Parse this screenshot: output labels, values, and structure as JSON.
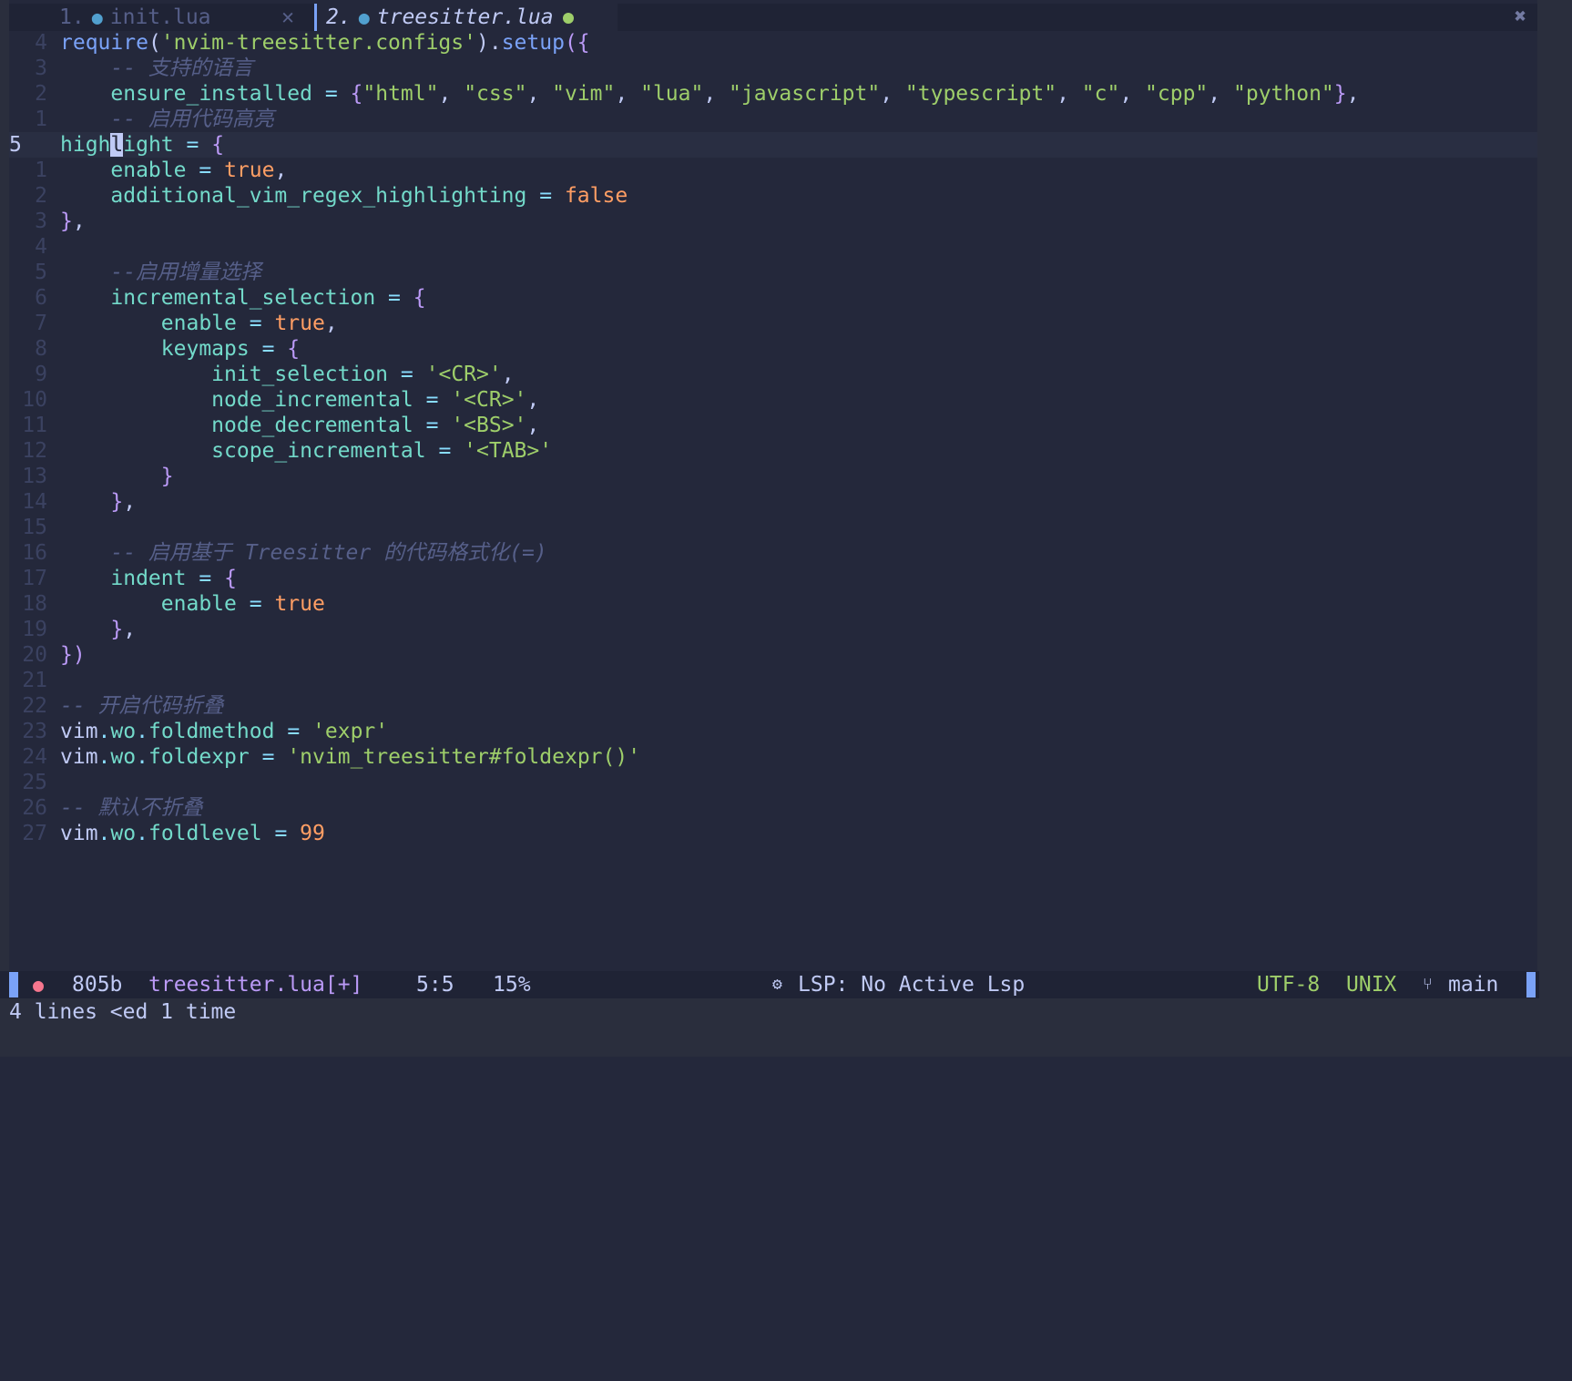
{
  "tabs": [
    {
      "number": "1.",
      "name": "init.lua",
      "close": "✕"
    },
    {
      "number": "2.",
      "name": "treesitter.lua"
    }
  ],
  "tabline": {
    "close_all": "✖"
  },
  "code_lines": [
    {
      "ln": "4",
      "html": "<span class='m'>require</span><span class='w'>(</span><span class='s'>'nvim-treesitter.configs'</span><span class='w'>).</span><span class='m'>setup</span><span class='p'>({</span>"
    },
    {
      "ln": "3",
      "html": "    <span class='c'>-- 支持的语言</span>"
    },
    {
      "ln": "2",
      "html": "    <span class='v'>ensure_installed</span> <span class='o'>=</span> <span class='p'>{</span><span class='s'>\"html\"</span><span class='w'>, </span><span class='s'>\"css\"</span><span class='w'>, </span><span class='s'>\"vim\"</span><span class='w'>, </span><span class='s'>\"lua\"</span><span class='w'>, </span><span class='s'>\"javascript\"</span><span class='w'>, </span><span class='s'>\"typescript\"</span><span class='w'>, </span><span class='s'>\"c\"</span><span class='w'>, </span><span class='s'>\"cpp\"</span><span class='w'>, </span><span class='s'>\"python\"</span><span class='p'>}</span><span class='w'>,</span>"
    },
    {
      "ln": "1",
      "html": "    <span class='c'>-- 启用代码高亮</span>"
    },
    {
      "ln": "5",
      "cur": true,
      "html": "<span class='v'>high</span><span class='cursor'>l</span><span class='v'>ight</span> <span class='o'>=</span> <span class='p'>{</span>"
    },
    {
      "ln": "1",
      "html": "    <span class='v'>enable</span> <span class='o'>=</span> <span class='k'>true</span><span class='w'>,</span>"
    },
    {
      "ln": "2",
      "html": "    <span class='v'>additional_vim_regex_highlighting</span> <span class='o'>=</span> <span class='k'>false</span>"
    },
    {
      "ln": "3",
      "html": "<span class='p'>}</span><span class='w'>,</span>"
    },
    {
      "ln": "4",
      "html": ""
    },
    {
      "ln": "5",
      "html": "    <span class='c'>--启用增量选择</span>"
    },
    {
      "ln": "6",
      "html": "    <span class='v'>incremental_selection</span> <span class='o'>=</span> <span class='p'>{</span>"
    },
    {
      "ln": "7",
      "html": "        <span class='v'>enable</span> <span class='o'>=</span> <span class='k'>true</span><span class='w'>,</span>"
    },
    {
      "ln": "8",
      "html": "        <span class='v'>keymaps</span> <span class='o'>=</span> <span class='p'>{</span>"
    },
    {
      "ln": "9",
      "html": "            <span class='v'>init_selection</span> <span class='o'>=</span> <span class='s'>'&lt;CR&gt;'</span><span class='w'>,</span>"
    },
    {
      "ln": "10",
      "html": "            <span class='v'>node_incremental</span> <span class='o'>=</span> <span class='s'>'&lt;CR&gt;'</span><span class='w'>,</span>"
    },
    {
      "ln": "11",
      "html": "            <span class='v'>node_decremental</span> <span class='o'>=</span> <span class='s'>'&lt;BS&gt;'</span><span class='w'>,</span>"
    },
    {
      "ln": "12",
      "html": "            <span class='v'>scope_incremental</span> <span class='o'>=</span> <span class='s'>'&lt;TAB&gt;'</span>"
    },
    {
      "ln": "13",
      "html": "        <span class='p'>}</span>"
    },
    {
      "ln": "14",
      "html": "    <span class='p'>}</span><span class='w'>,</span>"
    },
    {
      "ln": "15",
      "html": ""
    },
    {
      "ln": "16",
      "html": "    <span class='c'>-- 启用基于 Treesitter 的代码格式化(=)</span>"
    },
    {
      "ln": "17",
      "html": "    <span class='v'>indent</span> <span class='o'>=</span> <span class='p'>{</span>"
    },
    {
      "ln": "18",
      "html": "        <span class='v'>enable</span> <span class='o'>=</span> <span class='k'>true</span>"
    },
    {
      "ln": "19",
      "html": "    <span class='p'>}</span><span class='w'>,</span>"
    },
    {
      "ln": "20",
      "html": "<span class='p'>})</span>"
    },
    {
      "ln": "21",
      "html": ""
    },
    {
      "ln": "22",
      "html": "<span class='c'>-- 开启代码折叠</span>"
    },
    {
      "ln": "23",
      "html": "<span class='w'>vim</span><span class='o'>.</span><span class='v'>wo</span><span class='o'>.</span><span class='v'>foldmethod</span> <span class='o'>=</span> <span class='s'>'expr'</span>"
    },
    {
      "ln": "24",
      "html": "<span class='w'>vim</span><span class='o'>.</span><span class='v'>wo</span><span class='o'>.</span><span class='v'>foldexpr</span> <span class='o'>=</span> <span class='s'>'nvim_treesitter#foldexpr()'</span>"
    },
    {
      "ln": "25",
      "html": ""
    },
    {
      "ln": "26",
      "html": "<span class='c'>-- 默认不折叠</span>"
    },
    {
      "ln": "27",
      "html": "<span class='w'>vim</span><span class='o'>.</span><span class='v'>wo</span><span class='o'>.</span><span class='v'>foldlevel</span> <span class='o'>=</span> <span class='k'>99</span>"
    }
  ],
  "statusline": {
    "size": "805b",
    "filename": "treesitter.lua[+]",
    "position": "5:5",
    "percent": "15%",
    "lsp": "LSP: No Active Lsp",
    "encoding": "UTF-8",
    "fileformat": "UNIX",
    "branch": "main"
  },
  "cmdline": "4 lines <ed 1 time",
  "colors": {
    "background": "#24283b",
    "comment": "#565f89",
    "string": "#9ece6a",
    "keyword": "#ff9e64",
    "accent": "#7aa2f7"
  }
}
